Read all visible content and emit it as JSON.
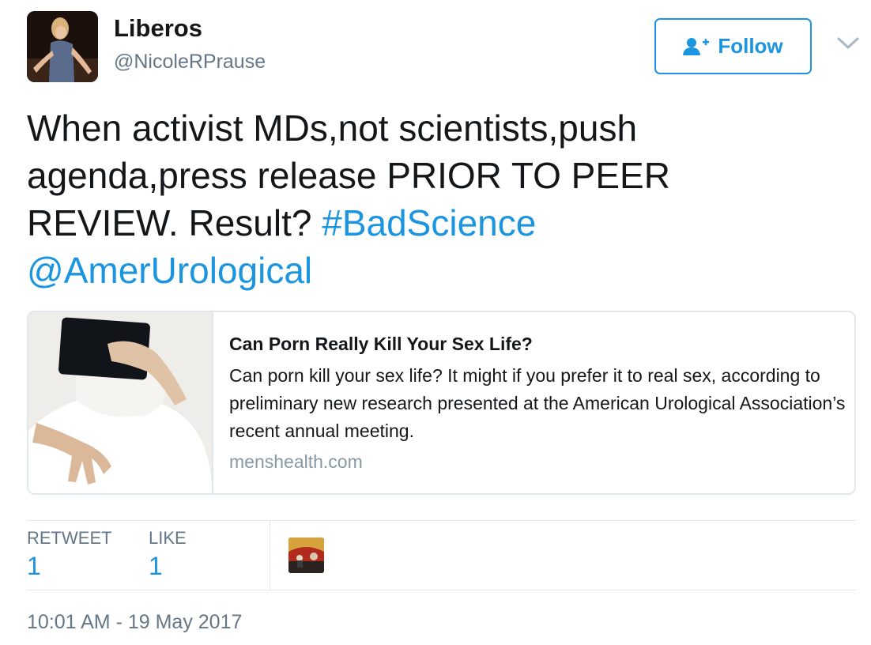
{
  "user": {
    "display_name": "Liberos",
    "handle": "@NicoleRPrause",
    "avatar_icon": "profile-photo"
  },
  "follow_button": {
    "label": "Follow",
    "icon": "add-user-icon"
  },
  "menu": {
    "icon": "chevron-down-icon"
  },
  "tweet": {
    "text_lines": [
      "When activist MDs,not scientists,push",
      "agenda,press release PRIOR TO PEER",
      "REVIEW. Result? "
    ],
    "hashtag": "#BadScience",
    "mention": "@AmerUrological"
  },
  "card": {
    "title": "Can Porn Really Kill Your Sex Life?",
    "description": "Can porn kill your sex life? It might if you prefer it to real sex, according to preliminary new research presented at the American Urological Association’s recent annual meeting.",
    "domain": "menshealth.com"
  },
  "stats": {
    "retweet_label": "RETWEET",
    "retweet_count": "1",
    "like_label": "LIKE",
    "like_count": "1"
  },
  "timestamp": "10:01 AM - 19 May 2017",
  "colors": {
    "accent": "#1b95e0",
    "secondary_text": "#657786",
    "border": "#e1e8ed",
    "text": "#14171a"
  }
}
